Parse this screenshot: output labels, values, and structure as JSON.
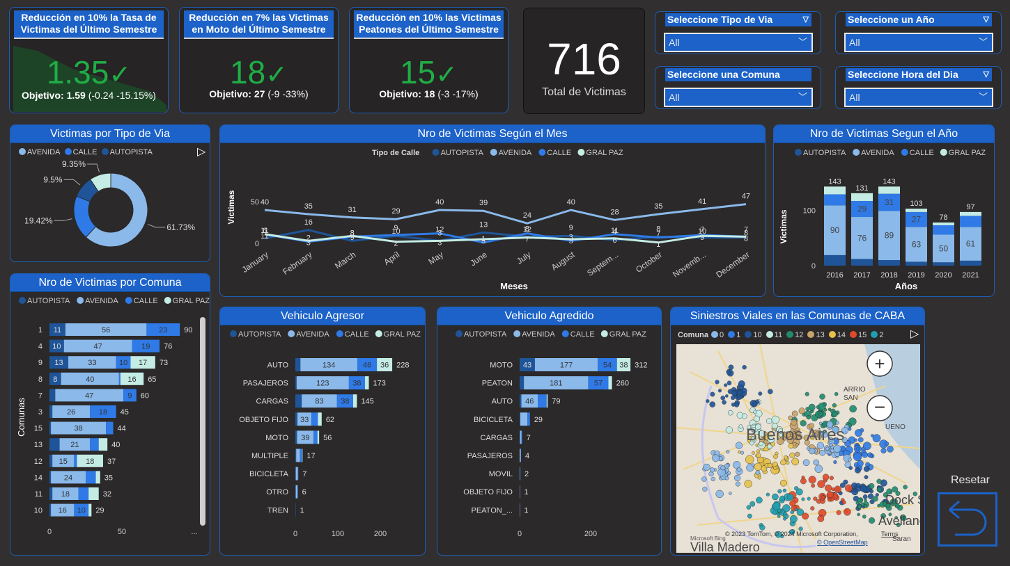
{
  "colors": {
    "autopista": "#1f5598",
    "avenida": "#8ab9ea",
    "calle": "#2f7ae6",
    "gralpaz": "#c4ece4",
    "kpi": "#1fae46",
    "header": "#1c62c9"
  },
  "kpis": [
    {
      "title": "Reducción en 10% la Tasa de Victimas del Último Semestre",
      "value": "1.35",
      "check": "✓",
      "objective_label": "Objetivo:",
      "objective_value": "1.59",
      "objective_delta": "(-0.24 -15.15%)"
    },
    {
      "title": "Reducción en 7% las Victimas en Moto del Último Semestre",
      "value": "18",
      "check": "✓",
      "objective_label": "Objetivo:",
      "objective_value": "27",
      "objective_delta": "(-9 -33%)"
    },
    {
      "title": "Reducción en 10% las Victimas Peatones del Último Semestre",
      "value": "15",
      "check": "✓",
      "objective_label": "Objetivo:",
      "objective_value": "18",
      "objective_delta": "(-3 -17%)"
    }
  ],
  "total": {
    "value": "716",
    "label": "Total de Victimas"
  },
  "slicers": [
    {
      "label": "Seleccione Tipo de Via",
      "value": "All"
    },
    {
      "label": "Seleccione un Año",
      "value": "All"
    },
    {
      "label": "Seleccione una Comuna",
      "value": "All"
    },
    {
      "label": "Seleccione Hora del Dia",
      "value": "All"
    }
  ],
  "reset_label": "Resetar",
  "chart_data": [
    {
      "type": "pie",
      "title": "Victimas por Tipo de Via",
      "legend": [
        "AVENIDA",
        "CALLE",
        "AUTOPISTA"
      ],
      "slices": [
        {
          "name": "AVENIDA",
          "value": 61.73,
          "label": "61.73%"
        },
        {
          "name": "CALLE",
          "value": 19.42,
          "label": "19.42%"
        },
        {
          "name": "AUTOPISTA",
          "value": 9.5,
          "label": "9.5%"
        },
        {
          "name": "GRAL PAZ",
          "value": 9.35,
          "label": "9.35%"
        }
      ]
    },
    {
      "type": "line",
      "title": "Nro de Victimas Según el Mes",
      "legend_title": "Tipo de Calle",
      "xlabel": "Meses",
      "ylabel": "Victimas",
      "ylim": [
        0,
        50
      ],
      "yticks": [
        0,
        50
      ],
      "x": [
        "January",
        "February",
        "March",
        "April",
        "May",
        "June",
        "July",
        "August",
        "Septem...",
        "October",
        "Novemb...",
        "December"
      ],
      "series": [
        {
          "name": "AUTOPISTA",
          "values": [
            6,
            16,
            3,
            9,
            3,
            13,
            8,
            9,
            4,
            8,
            7,
            7
          ]
        },
        {
          "name": "AVENIDA",
          "values": [
            40,
            35,
            31,
            29,
            40,
            39,
            24,
            40,
            28,
            35,
            41,
            47
          ]
        },
        {
          "name": "CALLE",
          "values": [
            11,
            2,
            8,
            10,
            12,
            1,
            12,
            3,
            11,
            7,
            10,
            8
          ]
        },
        {
          "name": "GRAL PAZ",
          "values": [
            11,
            3,
            9,
            2,
            3,
            5,
            7,
            5,
            6,
            1,
            9,
            8
          ]
        }
      ]
    },
    {
      "type": "bar",
      "title": "Nro de Victimas Segun el Año",
      "xlabel": "Años",
      "ylabel": "Victimas",
      "ylim": [
        0,
        150
      ],
      "yticks": [
        0,
        100
      ],
      "categories": [
        "2016",
        "2017",
        "2018",
        "2019",
        "2020",
        "2021"
      ],
      "totals": [
        143,
        131,
        143,
        103,
        78,
        97
      ],
      "series": [
        {
          "name": "AUTOPISTA",
          "values": [
            19,
            12,
            10,
            7,
            6,
            9
          ]
        },
        {
          "name": "AVENIDA",
          "values": [
            90,
            76,
            89,
            63,
            50,
            61
          ]
        },
        {
          "name": "CALLE",
          "values": [
            20,
            29,
            31,
            27,
            17,
            20
          ]
        },
        {
          "name": "GRAL PAZ",
          "values": [
            14,
            14,
            13,
            6,
            5,
            7
          ]
        }
      ]
    },
    {
      "type": "bar",
      "orientation": "horizontal",
      "title": "Nro de Victimas por Comuna",
      "ylabel": "Comunas",
      "xticks": [
        "0",
        "50",
        "..."
      ],
      "categories": [
        "1",
        "4",
        "9",
        "8",
        "7",
        "3",
        "15",
        "13",
        "12",
        "14",
        "11",
        "10"
      ],
      "totals": [
        90,
        76,
        73,
        65,
        60,
        45,
        44,
        40,
        37,
        35,
        32,
        29
      ],
      "series": [
        {
          "name": "AUTOPISTA",
          "values": [
            11,
            10,
            13,
            8,
            4,
            2,
            1,
            7,
            2,
            1,
            2,
            1
          ]
        },
        {
          "name": "AVENIDA",
          "values": [
            56,
            47,
            33,
            40,
            47,
            26,
            38,
            21,
            15,
            24,
            18,
            16
          ]
        },
        {
          "name": "CALLE",
          "values": [
            23,
            19,
            10,
            1,
            9,
            18,
            5,
            6,
            2,
            7,
            7,
            10
          ]
        },
        {
          "name": "GRAL PAZ",
          "values": [
            0,
            0,
            17,
            16,
            0,
            0,
            0,
            6,
            18,
            3,
            7,
            2
          ]
        }
      ]
    },
    {
      "type": "bar",
      "orientation": "horizontal",
      "title": "Vehiculo Agresor",
      "xticks": [
        "0",
        "100",
        "200"
      ],
      "categories": [
        "AUTO",
        "PASAJEROS",
        "CARGAS",
        "OBJETO FIJO",
        "MOTO",
        "MULTIPLE",
        "BICICLETA",
        "OTRO",
        "TREN"
      ],
      "totals": [
        228,
        173,
        145,
        62,
        56,
        17,
        7,
        6,
        1
      ],
      "series": [
        {
          "name": "AUTOPISTA",
          "values": [
            12,
            3,
            15,
            5,
            4,
            2,
            1,
            1,
            1
          ]
        },
        {
          "name": "AVENIDA",
          "values": [
            134,
            123,
            83,
            33,
            39,
            9,
            5,
            4,
            0
          ]
        },
        {
          "name": "CALLE",
          "values": [
            46,
            38,
            38,
            15,
            9,
            5,
            1,
            1,
            0
          ]
        },
        {
          "name": "GRAL PAZ",
          "values": [
            36,
            9,
            9,
            9,
            4,
            1,
            0,
            0,
            0
          ]
        }
      ]
    },
    {
      "type": "bar",
      "orientation": "horizontal",
      "title": "Vehiculo Agredido",
      "xticks": [
        "0",
        "200"
      ],
      "categories": [
        "MOTO",
        "PEATON",
        "AUTO",
        "BICICLETA",
        "CARGAS",
        "PASAJEROS",
        "MOVIL",
        "OBJETO FIJO",
        "PEATON_..."
      ],
      "totals": [
        312,
        260,
        79,
        29,
        7,
        4,
        2,
        1,
        1
      ],
      "series": [
        {
          "name": "AUTOPISTA",
          "values": [
            43,
            12,
            5,
            2,
            1,
            0,
            0,
            0,
            0
          ]
        },
        {
          "name": "AVENIDA",
          "values": [
            177,
            181,
            46,
            20,
            4,
            3,
            1,
            1,
            1
          ]
        },
        {
          "name": "CALLE",
          "values": [
            54,
            57,
            25,
            7,
            2,
            1,
            1,
            0,
            0
          ]
        },
        {
          "name": "GRAL PAZ",
          "values": [
            38,
            10,
            3,
            0,
            0,
            0,
            0,
            0,
            0
          ]
        }
      ]
    }
  ],
  "map": {
    "title": "Siniestros Viales en las Comunas de CABA",
    "legend_title": "Comuna",
    "legend": [
      {
        "label": "0",
        "color": "#8ab9ea"
      },
      {
        "label": "1",
        "color": "#2f7ae6"
      },
      {
        "label": "10",
        "color": "#1f5598"
      },
      {
        "label": "11",
        "color": "#c4ece4"
      },
      {
        "label": "12",
        "color": "#1f8a6e"
      },
      {
        "label": "13",
        "color": "#c8a36a"
      },
      {
        "label": "14",
        "color": "#e8c14a"
      },
      {
        "label": "15",
        "color": "#e04a2a"
      },
      {
        "label": "2",
        "color": "#1f9fb0"
      }
    ],
    "city_label": "Buenos Aires",
    "place_labels": [
      "Dock S",
      "Avellaned",
      "Villa Madero",
      "ARRIO",
      "SAN",
      "UENO",
      "Saran"
    ],
    "attribution": "© 2023 TomTom, © 2024 Microsoft Corporation,",
    "terms": "Terms",
    "osm": "© OpenStreetMap",
    "bing": "Microsoft Bing"
  }
}
